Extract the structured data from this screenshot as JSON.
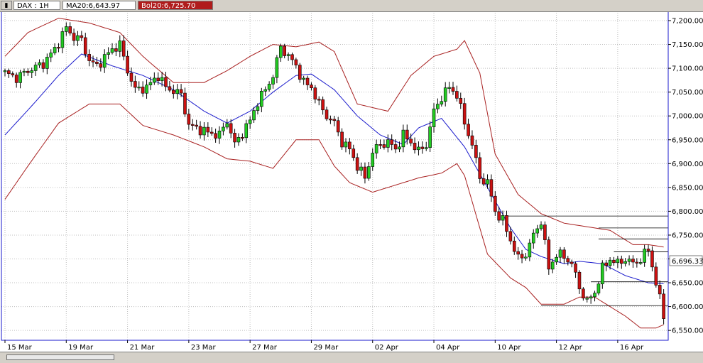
{
  "header": {
    "window_icon": "chart-window-icon",
    "symbol": "DAX : 1H",
    "ma_label": "MA20:6,643.97",
    "bol_label": "Bol20:6,725.70"
  },
  "footer": {
    "scrollbar": "horizontal-scrollbar"
  },
  "colors": {
    "up": "#22cc22",
    "down": "#cc1111",
    "ma": "#1a1acc",
    "bands": "#a82020",
    "grid": "#bfbfbf",
    "hlines": "#000000",
    "price_label_bg": "#ffffff"
  },
  "chart_data": {
    "type": "candlestick",
    "title": "",
    "interval": "1H",
    "y_ticks": [
      "7,200.00",
      "7,150.00",
      "7,100.00",
      "7,050.00",
      "7,000.00",
      "6,950.00",
      "6,900.00",
      "6,850.00",
      "6,800.00",
      "6,750.00",
      "6,700.00",
      "6,650.00",
      "6,600.00",
      "6,550.00"
    ],
    "ylim": [
      6530,
      7225
    ],
    "x_ticks": [
      "15 Mar",
      "19 Mar",
      "21 Mar",
      "23 Mar",
      "27 Mar",
      "29 Mar",
      "02 Apr",
      "04 Apr",
      "10 Apr",
      "12 Apr",
      "16 Apr"
    ],
    "x_tick_index": [
      0,
      16,
      32,
      48,
      64,
      80,
      96,
      112,
      128,
      144,
      160
    ],
    "last_price": "6,696.33",
    "ma_series": [
      [
        0,
        6960
      ],
      [
        8,
        7030
      ],
      [
        14,
        7085
      ],
      [
        20,
        7130
      ],
      [
        28,
        7105
      ],
      [
        36,
        7085
      ],
      [
        44,
        7055
      ],
      [
        52,
        7010
      ],
      [
        58,
        6985
      ],
      [
        64,
        7010
      ],
      [
        70,
        7050
      ],
      [
        76,
        7085
      ],
      [
        80,
        7088
      ],
      [
        86,
        7055
      ],
      [
        92,
        7000
      ],
      [
        98,
        6960
      ],
      [
        104,
        6940
      ],
      [
        108,
        6975
      ],
      [
        114,
        6995
      ],
      [
        120,
        6935
      ],
      [
        126,
        6850
      ],
      [
        132,
        6765
      ],
      [
        136,
        6720
      ],
      [
        140,
        6705
      ],
      [
        146,
        6690
      ],
      [
        150,
        6695
      ],
      [
        156,
        6690
      ],
      [
        162,
        6665
      ],
      [
        168,
        6650
      ],
      [
        172,
        6648
      ]
    ],
    "upper_band": [
      [
        0,
        7125
      ],
      [
        6,
        7175
      ],
      [
        14,
        7205
      ],
      [
        22,
        7195
      ],
      [
        30,
        7175
      ],
      [
        36,
        7125
      ],
      [
        44,
        7070
      ],
      [
        52,
        7070
      ],
      [
        58,
        7095
      ],
      [
        64,
        7125
      ],
      [
        70,
        7150
      ],
      [
        76,
        7145
      ],
      [
        82,
        7155
      ],
      [
        86,
        7135
      ],
      [
        92,
        7025
      ],
      [
        100,
        7010
      ],
      [
        106,
        7085
      ],
      [
        112,
        7125
      ],
      [
        118,
        7140
      ],
      [
        120,
        7158
      ],
      [
        124,
        7090
      ],
      [
        128,
        6920
      ],
      [
        134,
        6835
      ],
      [
        140,
        6795
      ],
      [
        146,
        6775
      ],
      [
        150,
        6770
      ],
      [
        154,
        6765
      ],
      [
        158,
        6760
      ],
      [
        164,
        6730
      ],
      [
        168,
        6730
      ],
      [
        172,
        6725
      ]
    ],
    "lower_band": [
      [
        0,
        6825
      ],
      [
        6,
        6895
      ],
      [
        14,
        6985
      ],
      [
        22,
        7025
      ],
      [
        30,
        7025
      ],
      [
        36,
        6980
      ],
      [
        44,
        6960
      ],
      [
        52,
        6935
      ],
      [
        58,
        6910
      ],
      [
        64,
        6905
      ],
      [
        70,
        6890
      ],
      [
        76,
        6950
      ],
      [
        82,
        6950
      ],
      [
        86,
        6895
      ],
      [
        90,
        6860
      ],
      [
        96,
        6840
      ],
      [
        102,
        6855
      ],
      [
        108,
        6870
      ],
      [
        114,
        6880
      ],
      [
        118,
        6900
      ],
      [
        120,
        6875
      ],
      [
        126,
        6710
      ],
      [
        132,
        6660
      ],
      [
        136,
        6640
      ],
      [
        140,
        6605
      ],
      [
        146,
        6605
      ],
      [
        150,
        6620
      ],
      [
        154,
        6620
      ],
      [
        158,
        6600
      ],
      [
        162,
        6580
      ],
      [
        166,
        6555
      ],
      [
        170,
        6555
      ],
      [
        172,
        6562
      ]
    ],
    "support_resistance": [
      {
        "value": 6790,
        "from": 131
      },
      {
        "value": 6765,
        "from": 155
      },
      {
        "value": 6742,
        "from": 155
      },
      {
        "value": 6715,
        "from": 159
      },
      {
        "value": 6652,
        "from": 153
      },
      {
        "value": 6602,
        "from": 140
      }
    ]
  }
}
